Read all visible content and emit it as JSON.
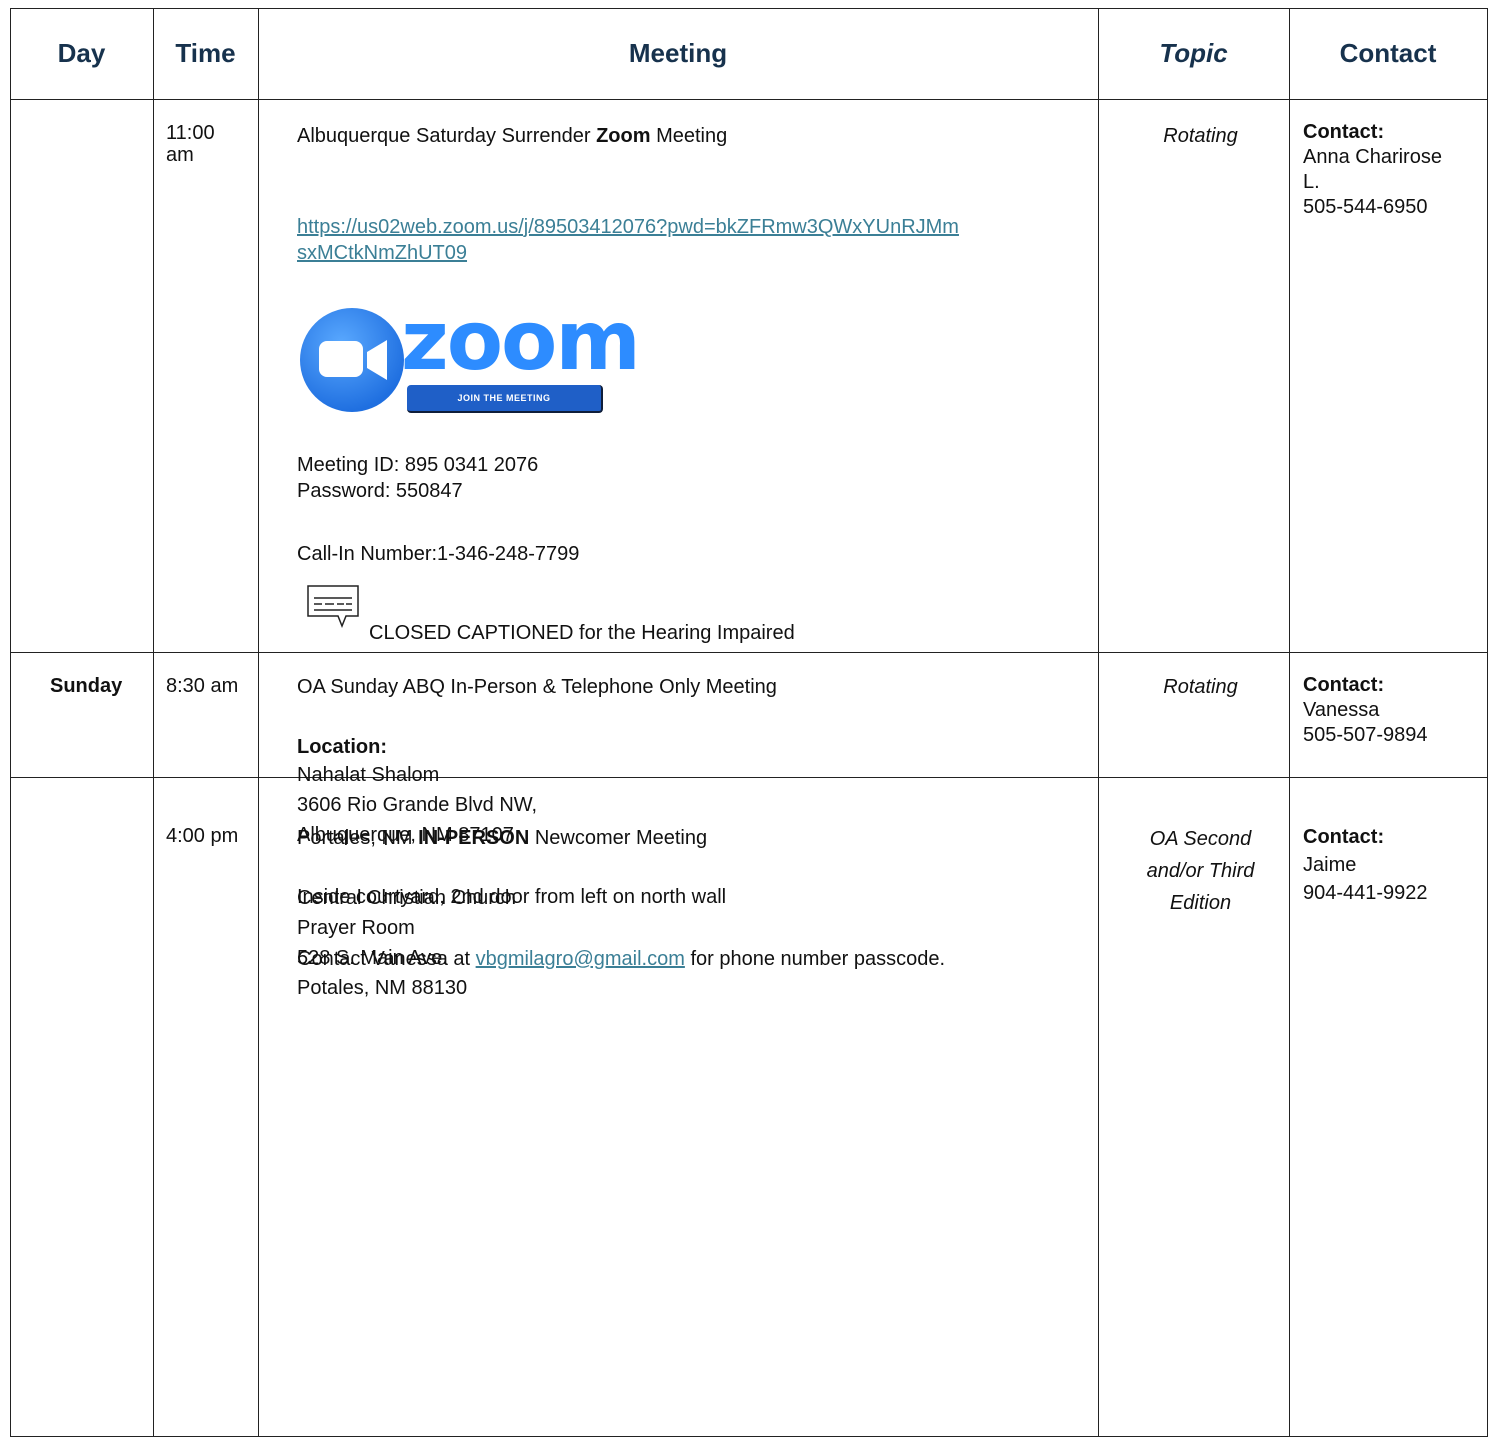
{
  "header": {
    "day": "Day",
    "time": "Time",
    "meeting": "Meeting",
    "topic": "Topic",
    "contact": "Contact"
  },
  "rows": [
    {
      "day": "",
      "time_line1": "11:00",
      "time_line2": "am",
      "meeting_pre": "Albuquerque Saturday Surrender ",
      "meeting_bold": "Zoom",
      "meeting_post": " Meeting",
      "url_line1": "https://us02web.zoom.us/j/89503412076?pwd=bkZFRmw3QWxYUnRJMm",
      "url_line2": "sxMCtkNmZhUT09",
      "zoom_word": "zoom",
      "join_label": "JOIN THE MEETING",
      "meeting_id": "Meeting ID: 895 0341 2076",
      "password": "Password: 550847",
      "call_in": "Call-In Number:1-346-248-7799",
      "captions": "CLOSED CAPTIONED for the Hearing Impaired",
      "topic": "Rotating",
      "contact_label": "Contact:",
      "contact_name_1": "Anna Charirose",
      "contact_name_2": "L.",
      "contact_phone": "505-544-6950"
    },
    {
      "day": "Sunday",
      "time": "8:30 am",
      "meeting_title": "OA Sunday ABQ In-Person & Telephone Only  Meeting",
      "location_label": "Location:",
      "loc_1": "Nahalat Shalom",
      "loc_2": "3606 Rio Grande Blvd NW,",
      "loc_3": "Albuquerque, NM  87107",
      "directions": "Inside courtyard, 2nd door from left on north wall",
      "contact_pre": "Contact Vanessa at ",
      "email": "vbgmilagro@gmail.com",
      "contact_post": " for phone number passcode.",
      "topic": "Rotating",
      "contact_label": "Contact:",
      "contact_name": "Vanessa",
      "contact_phone": "505-507-9894"
    },
    {
      "day": "",
      "time": "4:00 pm",
      "meeting_pre": "Portales, NM ",
      "meeting_bold": "IN-PERSON",
      "meeting_post": " Newcomer Meeting",
      "loc_1": "Central Christian Church",
      "loc_2": "Prayer Room",
      "loc_3": "528 S. Main Ave.",
      "loc_4": "Potales, NM  88130",
      "topic_1": "OA Second",
      "topic_2": "and/or Third",
      "topic_3": "Edition",
      "contact_label": "Contact:",
      "contact_name": "Jaime",
      "contact_phone": "904-441-9922"
    }
  ],
  "colors": {
    "header_text": "#17324d",
    "link": "#3b7f96",
    "zoom_blue": "#2d8cff"
  },
  "icons": {
    "zoom_logo": "camera-icon",
    "captions": "closed-caption-icon"
  }
}
